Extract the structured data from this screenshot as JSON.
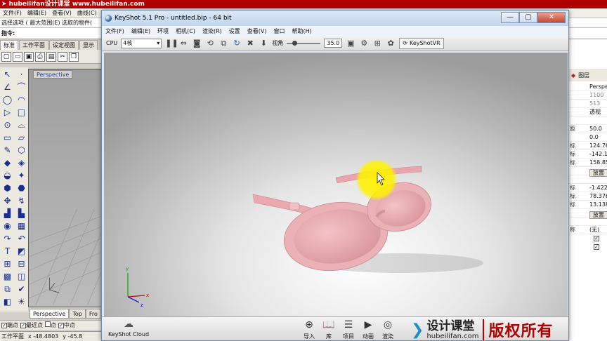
{
  "rhino": {
    "banner": "➤ hubeilifan设计课堂  www.hubeilifan.com",
    "menus": [
      "文件(F)",
      "编辑(E)",
      "查看(V)",
      "曲线(C)"
    ],
    "cmdline": "选择选项 ( 最大范围(E)  选取的物件(",
    "prompt": "指令:",
    "toolbar_tabs": [
      "标准",
      "工作平面",
      "设定视图",
      "显示"
    ],
    "std_icons": [
      "new-doc-icon",
      "open-folder-icon",
      "save-icon",
      "print-icon",
      "import-icon",
      "cut-icon",
      "copy-icon"
    ],
    "std_glyphs": [
      "▢",
      "▭",
      "▣",
      "⎙",
      "▤",
      "✂",
      "❐"
    ],
    "viewport_title": "Perspective",
    "viewport_tabs": [
      "Perspective",
      "Top",
      "Fro"
    ],
    "osnaps": [
      {
        "label": "端点",
        "checked": true
      },
      {
        "label": "最近点",
        "checked": true
      },
      {
        "label": "点",
        "checked": false
      },
      {
        "label": "中点",
        "checked": true
      }
    ],
    "status": {
      "plane": "工作平面",
      "x": "x -48.4803",
      "y": "y -45.8"
    },
    "tools": [
      "↖",
      "·",
      "∠",
      "⌒",
      "◯",
      "◠",
      "▷",
      "□",
      "⊙",
      "⌓",
      "▭",
      "▱",
      "✎",
      "⬡",
      "◆",
      "◈",
      "◒",
      "✦",
      "⬢",
      "⬣",
      "✥",
      "↯",
      "▟",
      "▙",
      "◉",
      "▦",
      "↷",
      "↶",
      "T",
      "◩",
      "⊞",
      "⊟",
      "▩",
      "◫",
      "⧉",
      "✔",
      "◧",
      "☀"
    ],
    "panel": {
      "tab_label": "图层",
      "rows": [
        {
          "k": "",
          "v": "Perspe",
          "dim": false
        },
        {
          "k": "",
          "v": "1100",
          "dim": true
        },
        {
          "k": "",
          "v": "513",
          "dim": true
        },
        {
          "k": "",
          "v": "透视",
          "dim": false
        },
        {
          "k": "",
          "v": "",
          "dim": false
        },
        {
          "k": "距",
          "v": "50.0",
          "dim": false
        },
        {
          "k": "",
          "v": "0.0",
          "dim": false
        },
        {
          "k": "标",
          "v": "124.767",
          "dim": false
        },
        {
          "k": "标",
          "v": "-142.15",
          "dim": false
        },
        {
          "k": "标",
          "v": "158.855",
          "dim": false
        },
        {
          "k": "",
          "v": "",
          "dim": false
        },
        {
          "k": "",
          "v": "",
          "dim": false
        },
        {
          "k": "标",
          "v": "-1.422",
          "dim": false
        },
        {
          "k": "标",
          "v": "78.376",
          "dim": false
        },
        {
          "k": "标",
          "v": "13.138",
          "dim": false
        },
        {
          "k": "",
          "v": "",
          "dim": false
        },
        {
          "k": "",
          "v": "",
          "dim": false
        },
        {
          "k": "称",
          "v": "(无)",
          "dim": false
        }
      ],
      "btn_label": "放置",
      "checks": [
        true,
        true
      ]
    }
  },
  "keyshot": {
    "title": "KeyShot 5.1 Pro  - untitled.bip  - 64 bit",
    "window_buttons": [
      "—",
      "▢",
      "✕"
    ],
    "menus": [
      "文件(F)",
      "编辑(E)",
      "环境",
      "相机(C)",
      "渲染(R)",
      "设置",
      "查看(V)",
      "窗口",
      "帮助(H)"
    ],
    "cpu_label": "CPU",
    "cpu_value": "4核",
    "fov_label": "视角",
    "fov_value": "35.0",
    "fov_fraction": 0.18,
    "vr_label": "KeyShotVR",
    "cloud_label": "KeyShot Cloud",
    "bottom_tabs": [
      {
        "label": "导入",
        "icon": "import-icon",
        "glyph": "⊕"
      },
      {
        "label": "库",
        "icon": "library-icon",
        "glyph": "📖"
      },
      {
        "label": "项目",
        "icon": "project-icon",
        "glyph": "☰"
      },
      {
        "label": "动画",
        "icon": "animation-icon",
        "glyph": "▶"
      },
      {
        "label": "渲染",
        "icon": "render-icon",
        "glyph": "◎"
      }
    ],
    "brand": {
      "cn": "设计课堂",
      "url": "hubeilifan.com",
      "copyright": "版权所有"
    },
    "axis_labels": {
      "x": "x",
      "y": "y",
      "z": "z"
    },
    "colors": {
      "glasses": "#eab1b6",
      "cursor_highlight": "#fff200",
      "brand_red": "#b10000"
    }
  }
}
